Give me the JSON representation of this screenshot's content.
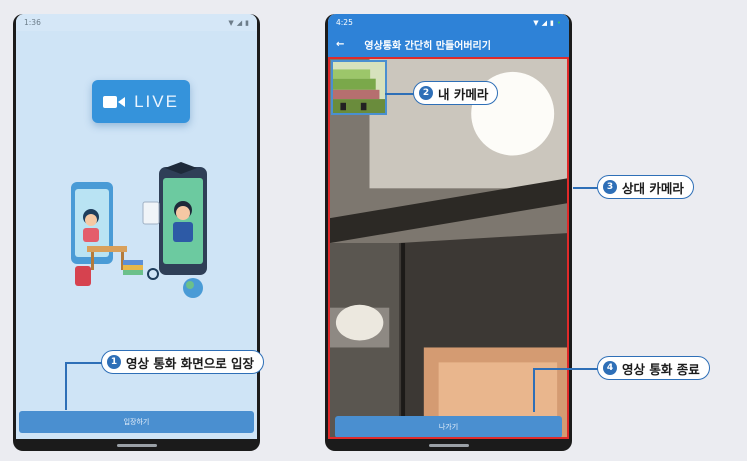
{
  "left_phone": {
    "status": {
      "time": "1:36"
    },
    "live_label": "LIVE",
    "enter_button": "입장하기"
  },
  "right_phone": {
    "status": {
      "time": "4:25"
    },
    "app_title": "영상통화 간단히 만들어버리기",
    "leave_button": "나가기"
  },
  "callouts": [
    {
      "num": "1",
      "label": "영상 통화 화면으로 입장"
    },
    {
      "num": "2",
      "label": "내 카메라"
    },
    {
      "num": "3",
      "label": "상대 카메라"
    },
    {
      "num": "4",
      "label": "영상 통화 종료"
    }
  ],
  "colors": {
    "primary": "#2e82d7",
    "button": "#4a8fd0",
    "callout": "#2e6fb7",
    "highlight": "#e02a2a"
  }
}
